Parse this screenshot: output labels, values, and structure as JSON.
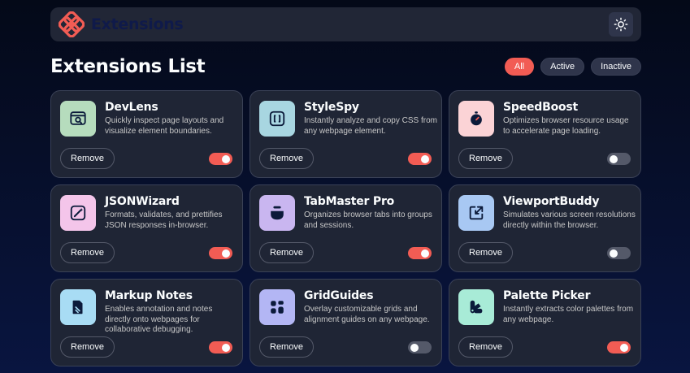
{
  "header": {
    "brand_name": "Extensions",
    "logo_icon": "extensions-logo-icon",
    "theme_icon": "sun-icon"
  },
  "page": {
    "title": "Extensions List"
  },
  "filters": [
    {
      "label": "All",
      "active": true
    },
    {
      "label": "Active",
      "active": false
    },
    {
      "label": "Inactive",
      "active": false
    }
  ],
  "colors": {
    "accent": "#f25c54",
    "card_bg": "#1f2535",
    "page_bg": "#091540"
  },
  "extensions": [
    {
      "name": "DevLens",
      "description": "Quickly inspect page layouts and visualize element boundaries.",
      "remove_label": "Remove",
      "enabled": true,
      "icon": "inspect-icon",
      "icon_bg": "#b6dcbd"
    },
    {
      "name": "StyleSpy",
      "description": "Instantly analyze and copy CSS from any webpage element.",
      "remove_label": "Remove",
      "enabled": true,
      "icon": "brackets-icon",
      "icon_bg": "#a8d6e1"
    },
    {
      "name": "SpeedBoost",
      "description": "Optimizes browser resource usage to accelerate page loading.",
      "remove_label": "Remove",
      "enabled": false,
      "icon": "stopwatch-icon",
      "icon_bg": "#fbd3d6"
    },
    {
      "name": "JSONWizard",
      "description": "Formats, validates, and prettifies JSON responses in-browser.",
      "remove_label": "Remove",
      "enabled": true,
      "icon": "wand-icon",
      "icon_bg": "#f4c5ea"
    },
    {
      "name": "TabMaster Pro",
      "description": "Organizes browser tabs into groups and sessions.",
      "remove_label": "Remove",
      "enabled": true,
      "icon": "stack-icon",
      "icon_bg": "#c9b6f0"
    },
    {
      "name": "ViewportBuddy",
      "description": "Simulates various screen resolutions directly within the browser.",
      "remove_label": "Remove",
      "enabled": false,
      "icon": "resize-icon",
      "icon_bg": "#a8c8f3"
    },
    {
      "name": "Markup Notes",
      "description": "Enables annotation and notes directly onto webpages for collaborative debugging.",
      "remove_label": "Remove",
      "enabled": true,
      "icon": "note-icon",
      "icon_bg": "#a8dcf4"
    },
    {
      "name": "GridGuides",
      "description": "Overlay customizable grids and alignment guides on any webpage.",
      "remove_label": "Remove",
      "enabled": false,
      "icon": "grid-icon",
      "icon_bg": "#b3b6f4"
    },
    {
      "name": "Palette Picker",
      "description": "Instantly extracts color palettes from any webpage.",
      "remove_label": "Remove",
      "enabled": true,
      "icon": "palette-icon",
      "icon_bg": "#a8ebd7"
    }
  ]
}
